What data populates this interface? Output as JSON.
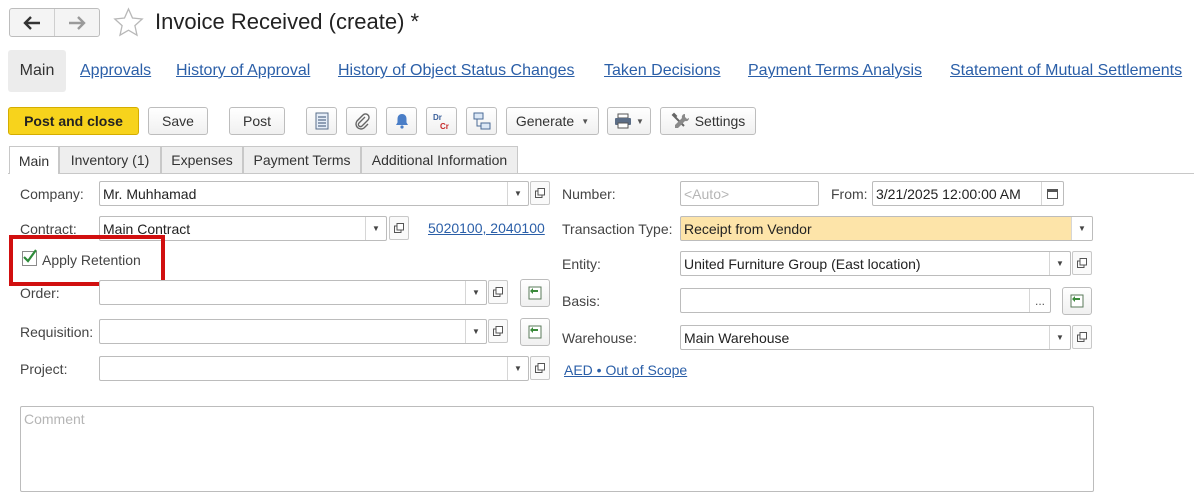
{
  "window": {
    "title": "Invoice Received (create) *"
  },
  "section_tabs": [
    {
      "label": "Main"
    },
    {
      "label": "Approvals"
    },
    {
      "label": "History of Approval"
    },
    {
      "label": "History of Object Status Changes"
    },
    {
      "label": "Taken Decisions"
    },
    {
      "label": "Payment Terms Analysis"
    },
    {
      "label": "Statement of Mutual Settlements"
    }
  ],
  "toolbar": {
    "post_close_label": "Post and close",
    "save_label": "Save",
    "post_label": "Post",
    "generate_label": "Generate",
    "settings_label": "Settings",
    "primary_color": "#f7d31c"
  },
  "form_tabs": [
    {
      "label": "Main"
    },
    {
      "label": "Inventory (1)"
    },
    {
      "label": "Expenses"
    },
    {
      "label": "Payment Terms"
    },
    {
      "label": "Additional Information"
    }
  ],
  "form": {
    "company": {
      "label": "Company:",
      "value": "Mr. Muhhamad"
    },
    "contract": {
      "label": "Contract:",
      "value": "Main Contract",
      "accounts_link": "5020100, 2040100"
    },
    "apply_retention": {
      "label": "Apply Retention",
      "checked": true,
      "highlight_color": "#d10f0f"
    },
    "order": {
      "label": "Order:",
      "value": ""
    },
    "requisition": {
      "label": "Requisition:",
      "value": ""
    },
    "project": {
      "label": "Project:",
      "value": ""
    },
    "number": {
      "label": "Number:",
      "placeholder": "<Auto>"
    },
    "from": {
      "label": "From:",
      "value": "3/21/2025 12:00:00 AM"
    },
    "transaction_type": {
      "label": "Transaction Type:",
      "value": "Receipt from Vendor",
      "bg_color": "#fde4a9"
    },
    "entity": {
      "label": "Entity:",
      "value": "United Furniture Group (East location)"
    },
    "basis": {
      "label": "Basis:",
      "value": ""
    },
    "warehouse": {
      "label": "Warehouse:",
      "value": "Main Warehouse"
    },
    "tax_link": "AED • Out of Scope",
    "comment": {
      "placeholder": "Comment"
    }
  }
}
